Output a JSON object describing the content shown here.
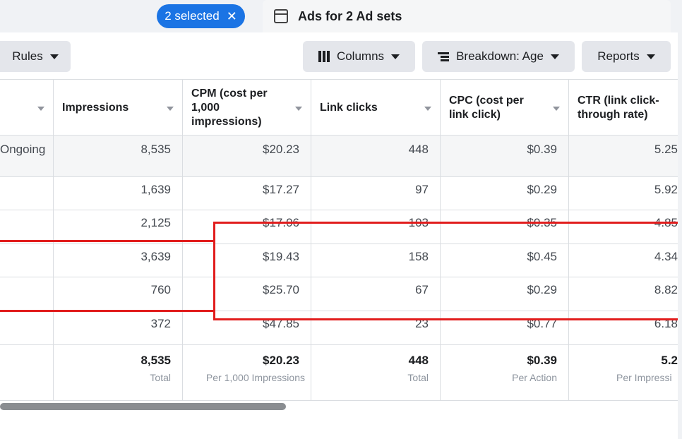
{
  "topbar": {
    "selected_label": "2 selected",
    "close_symbol": "✕",
    "ads_tab_title": "Ads for 2 Ad sets"
  },
  "toolbar": {
    "rules_label": "Rules",
    "columns_label": "Columns",
    "breakdown_label": "Breakdown: Age",
    "reports_label": "Reports"
  },
  "table": {
    "headers": [
      {
        "label": ""
      },
      {
        "label": "Impressions"
      },
      {
        "label": "CPM (cost per 1,000 impressions)"
      },
      {
        "label": "Link clicks"
      },
      {
        "label": "CPC (cost per link click)"
      },
      {
        "label": "CTR (link click-through rate)"
      }
    ],
    "rows": [
      [
        "Ongoing",
        "8,535",
        "$20.23",
        "448",
        "$0.39",
        "5.25"
      ],
      [
        "",
        "1,639",
        "$17.27",
        "97",
        "$0.29",
        "5.92"
      ],
      [
        "",
        "2,125",
        "$17.06",
        "103",
        "$0.35",
        "4.85"
      ],
      [
        "",
        "3,639",
        "$19.43",
        "158",
        "$0.45",
        "4.34"
      ],
      [
        "",
        "760",
        "$25.70",
        "67",
        "$0.29",
        "8.82"
      ],
      [
        "",
        "372",
        "$47.85",
        "23",
        "$0.77",
        "6.18"
      ]
    ],
    "totals": [
      {
        "value": "",
        "sub": ""
      },
      {
        "value": "8,535",
        "sub": "Total"
      },
      {
        "value": "$20.23",
        "sub": "Per 1,000 Impressions"
      },
      {
        "value": "448",
        "sub": "Total"
      },
      {
        "value": "$0.39",
        "sub": "Per Action"
      },
      {
        "value": "5.2",
        "sub": "Per Impressi"
      }
    ]
  },
  "colors": {
    "accent": "#1b74e4",
    "annotation": "#e11d1d"
  }
}
